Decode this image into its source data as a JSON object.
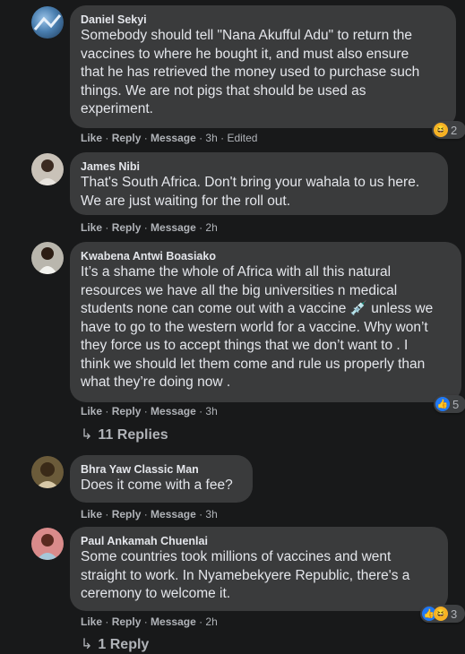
{
  "comments": [
    {
      "author": "Daniel Sekyi",
      "text": "Somebody should tell \"Nana Akufful Adu\" to return the\nvaccines to where he bought it, and must also ensure\nthat he has retrieved the money used to purchase such\nthings. We are not pigs that should be used as\nexperiment.",
      "like": "Like",
      "reply": "Reply",
      "message": "Message",
      "time": "3h",
      "edited": "Edited",
      "reaction_count": "2",
      "reaction_icons": [
        "laugh-emoji"
      ]
    },
    {
      "author": "James Nibi",
      "text": "That's South Africa. Don't bring your wahala to us here.\nWe are just waiting for the roll out.",
      "like": "Like",
      "reply": "Reply",
      "message": "Message",
      "time": "2h"
    },
    {
      "author": "Kwabena Antwi Boasiako",
      "text": "It’s a shame the whole of Africa with all this natural\nresources we have all the big universities n medical\nstudents none can come out with a vaccine 💉 unless we\nhave to go to the western world for a vaccine. Why won’t\nthey force us to accept things that we don’t want to . I\nthink we should let them come and rule us properly than\nwhat they’re doing now .",
      "like": "Like",
      "reply": "Reply",
      "message": "Message",
      "time": "3h",
      "reaction_count": "5",
      "reaction_icons": [
        "like-emoji"
      ],
      "replies_label": "11 Replies"
    },
    {
      "author": "Bhra Yaw Classic Man",
      "text": "Does it come with a fee?",
      "like": "Like",
      "reply": "Reply",
      "message": "Message",
      "time": "3h"
    },
    {
      "author": "Paul Ankamah Chuenlai",
      "text": "Some countries took millions of vaccines and went\nstraight to work. In Nyamebekyere Republic, there's a\nceremony to welcome it.",
      "like": "Like",
      "reply": "Reply",
      "message": "Message",
      "time": "2h",
      "reaction_count": "3",
      "reaction_icons": [
        "like-emoji",
        "laugh-emoji"
      ],
      "replies_label": "1 Reply"
    }
  ],
  "separator": " · ",
  "colors": {
    "background": "#18191a",
    "bubble": "#3a3b3c",
    "text": "#e4e6eb",
    "secondary": "#b0b3b8",
    "like_blue": "#2078f4",
    "laugh_yellow": "#f7b125"
  }
}
